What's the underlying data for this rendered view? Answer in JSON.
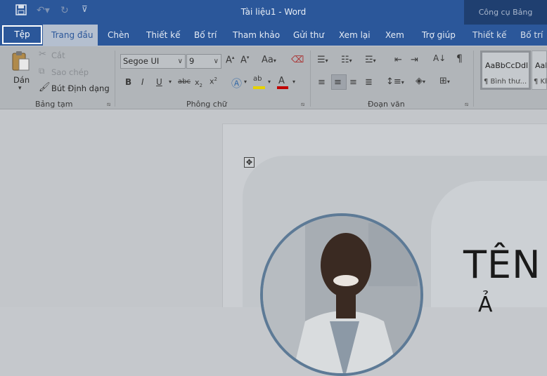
{
  "titlebar": {
    "document_title": "Tài liệu1  -  Word",
    "context_tools_label": "Công cụ Bảng"
  },
  "tabs": {
    "file": "Tệp",
    "home": "Trang đầu",
    "insert": "Chèn",
    "design": "Thiết kế",
    "layout": "Bố trí",
    "references": "Tham khảo",
    "mailings": "Gửi thư",
    "review": "Xem lại",
    "view": "Xem",
    "help": "Trợ giúp",
    "table_design": "Thiết kế",
    "table_layout": "Bố trí"
  },
  "clipboard": {
    "paste": "Dán",
    "cut": "Cắt",
    "copy": "Sao chép",
    "format_painter": "Bút Định dạng",
    "group_label": "Bảng tạm"
  },
  "font": {
    "font_name": "Segoe UI",
    "font_size": "9",
    "change_case": "Aa",
    "group_label": "Phông chữ"
  },
  "paragraph": {
    "group_label": "Đoạn văn"
  },
  "styles": {
    "normal_preview": "AaBbCcDdl",
    "normal_name": "¶ Bình thư...",
    "next_preview": "AaB",
    "next_name": "¶ Kh"
  },
  "document": {
    "heading_line1": "TÊN",
    "heading_line2": "Ả"
  },
  "colors": {
    "ribbon_blue": "#2b579a",
    "photo_ring": "#5d7a96",
    "font_color_bar": "#c00000",
    "highlight_bar": "#e6d200"
  }
}
